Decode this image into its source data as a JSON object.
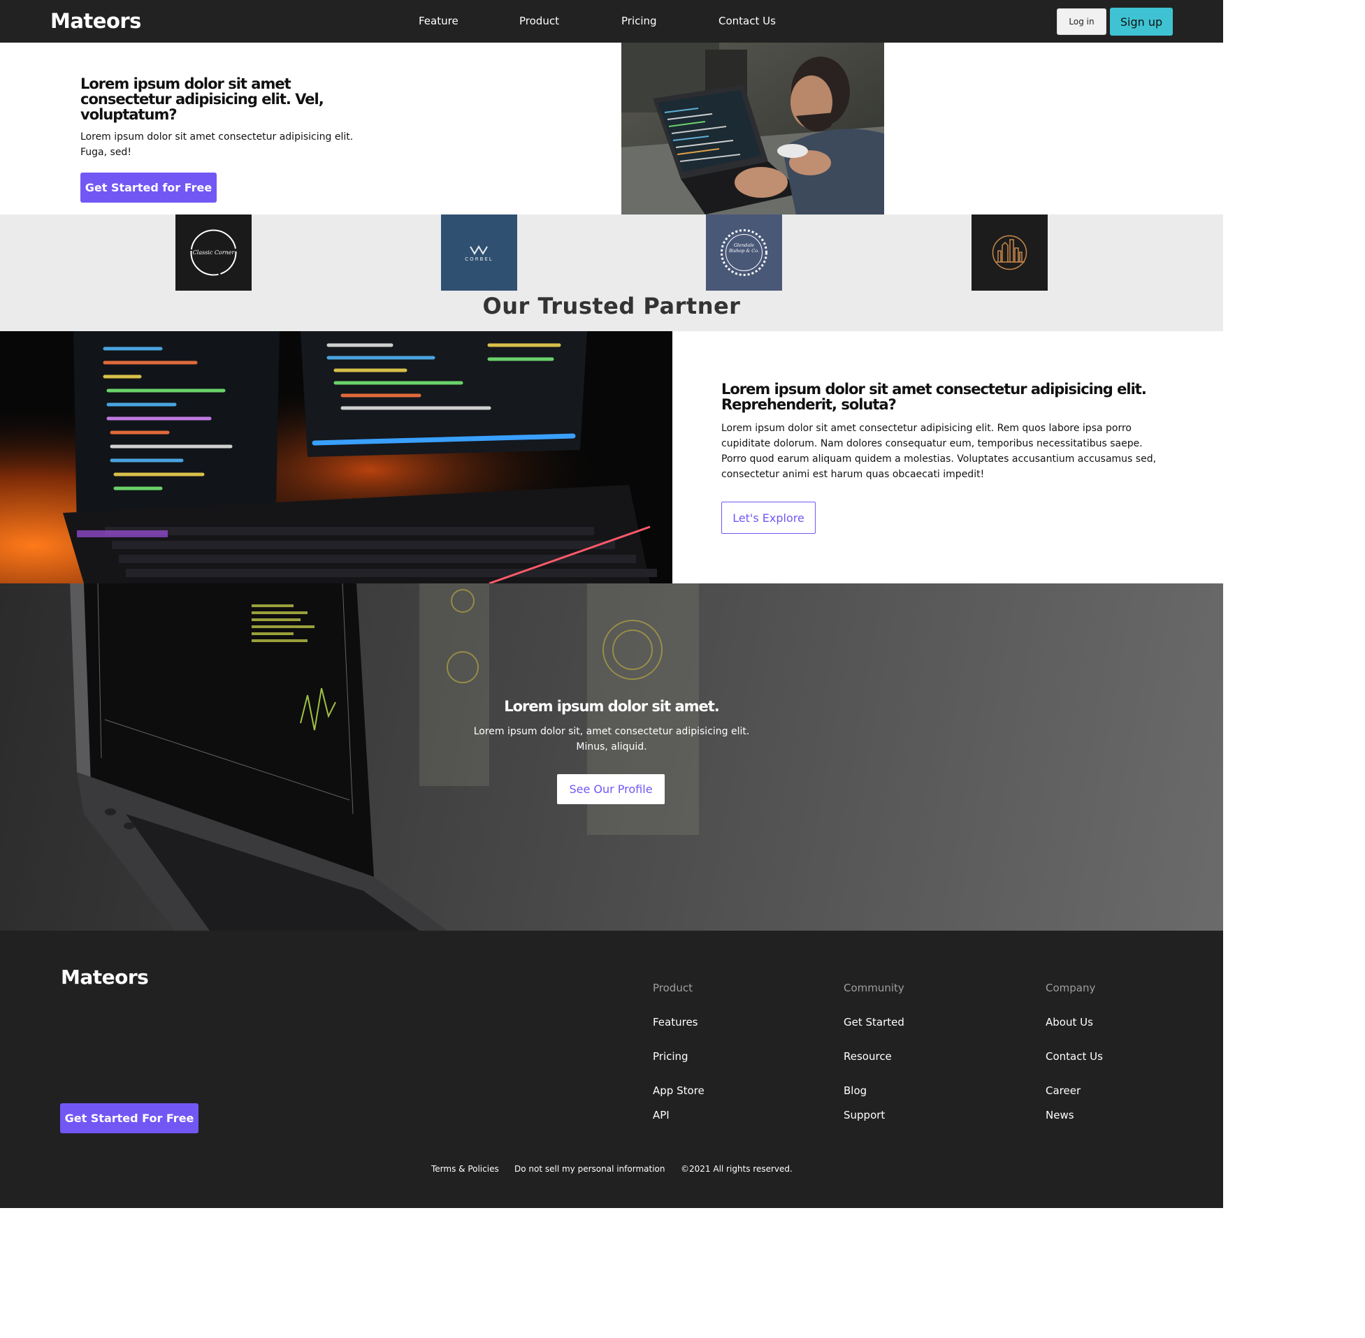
{
  "nav": {
    "brand": "Mateors",
    "links": [
      "Feature",
      "Product",
      "Pricing",
      "Contact Us"
    ],
    "login_label": "Log in",
    "signup_label": "Sign up"
  },
  "hero": {
    "title": "Lorem ipsum dolor sit amet consectetur adipisicing elit. Vel, voluptatum?",
    "text": "Lorem ipsum dolor sit amet consectetur adipisicing elit. Fuga, sed!",
    "cta_label": "Get Started for Free"
  },
  "partners": {
    "title": "Our Trusted Partner",
    "logos": [
      {
        "icon": "classic-circle-logo",
        "bg": "#1a1a1a",
        "text": "Classic Corner"
      },
      {
        "icon": "corbel-logo",
        "bg": "#2f5070",
        "text": "CORBEL"
      },
      {
        "icon": "glendale-badge-logo",
        "bg": "#4a5878",
        "text": "Glendale Bishop & Co."
      },
      {
        "icon": "city-skyline-logo",
        "bg": "#1c1c1c",
        "text": ""
      }
    ]
  },
  "feature": {
    "title": "Lorem ipsum dolor sit amet consectetur adipisicing elit. Reprehenderit, soluta?",
    "text": "Lorem ipsum dolor sit amet consectetur adipisicing elit. Rem quos labore ipsa porro cupiditate dolorum. Nam dolores consequatur eum, temporibus necessitatibus saepe. Porro quod earum aliquam quidem a molestias. Voluptates accusantium accusamus sed, consectetur animi est harum quas obcaecati impedit!",
    "cta_label": "Let's Explore"
  },
  "banner": {
    "title": "Lorem ipsum dolor sit amet.",
    "text": "Lorem ipsum dolor sit, amet consectetur adipisicing elit. Minus, aliquid.",
    "cta_label": "See Our Profile"
  },
  "footer": {
    "brand": "Mateors",
    "cta_label": "Get Started For Free",
    "columns": [
      {
        "heading": "Product",
        "items": [
          "Features",
          "Pricing",
          "App Store",
          "API"
        ]
      },
      {
        "heading": "Community",
        "items": [
          "Get Started",
          "Resource",
          "Blog",
          "Support"
        ]
      },
      {
        "heading": "Company",
        "items": [
          "About Us",
          "Contact Us",
          "Career",
          "News"
        ]
      }
    ],
    "legal": {
      "terms": "Terms & Policies",
      "privacy": "Do not sell my personal information",
      "copyright": "©2021 All rights reserved."
    }
  },
  "colors": {
    "accent": "#7257f5",
    "signup": "#3fc3d3",
    "nav_bg": "#222222",
    "footer_bg": "#212121",
    "partners_bg": "#ebebeb"
  }
}
